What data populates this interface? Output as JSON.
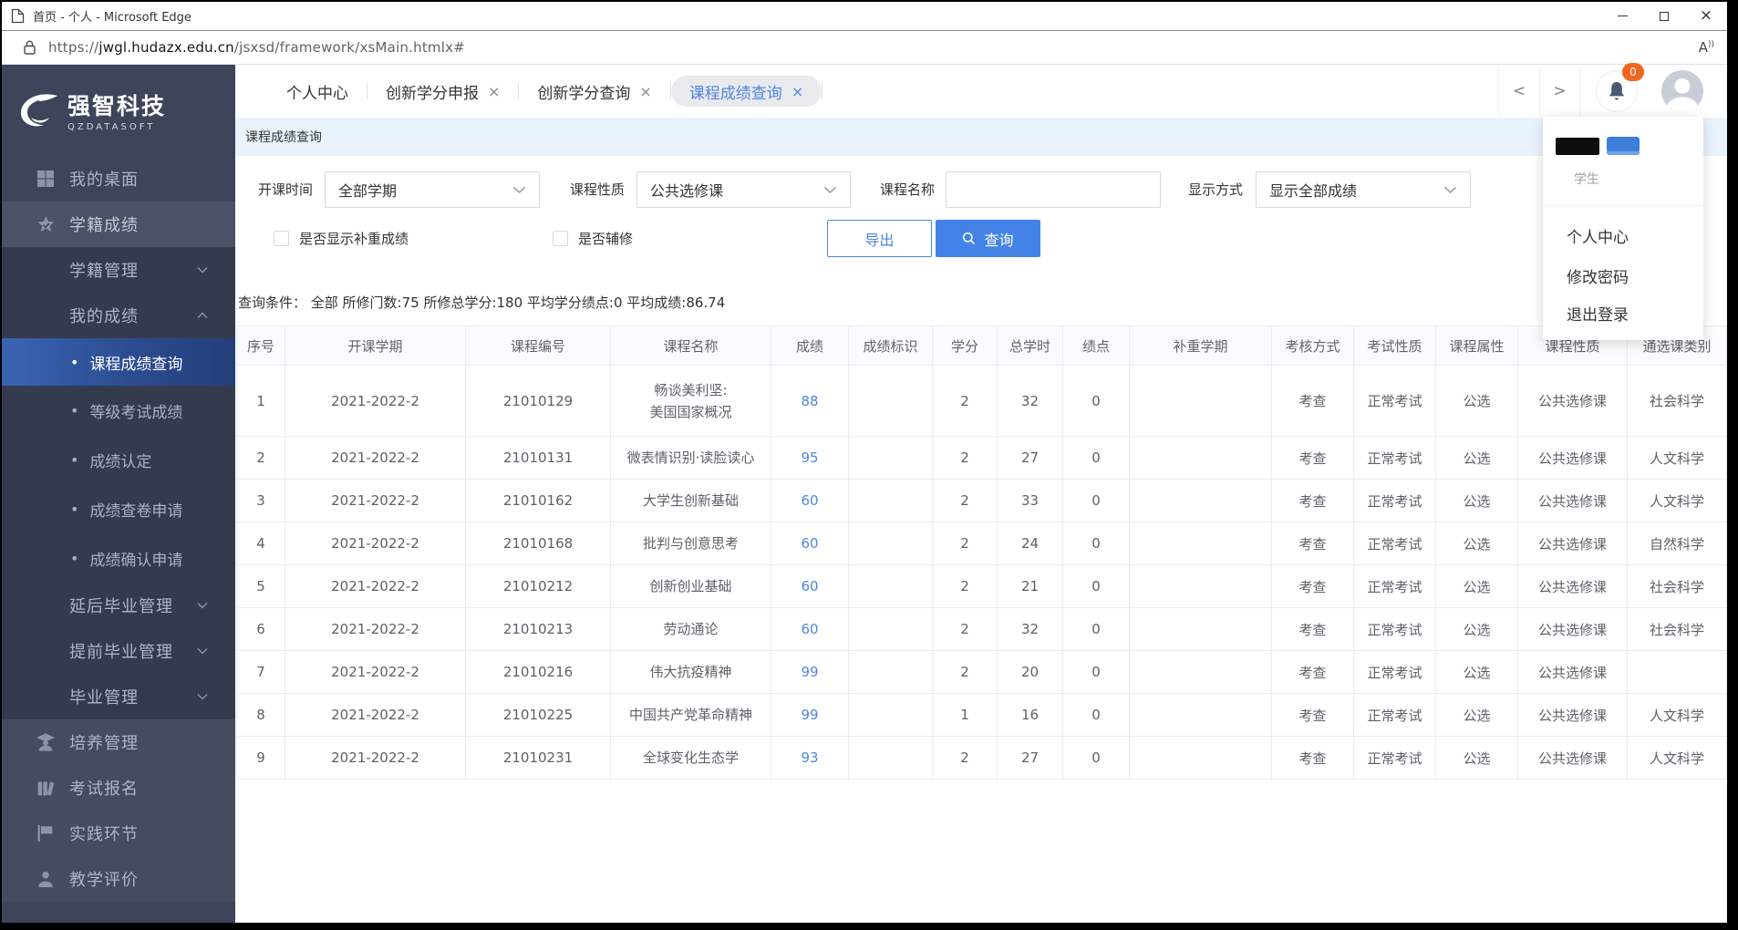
{
  "window": {
    "title": "首页 - 个人 - Microsoft Edge"
  },
  "address": {
    "scheme": "https://",
    "domain": "jwgl.hudazx.edu.cn",
    "path": "/jsxsd/framework/xsMain.htmlx#",
    "read_aloud": "A"
  },
  "logo": {
    "title": "强智科技",
    "subtitle": "QZDATASOFT"
  },
  "sidebar": {
    "sections": [
      {
        "style": "plain",
        "items": [
          {
            "label": "我的桌面",
            "icon": "desktop-icon"
          }
        ]
      },
      {
        "style": "highlight",
        "items": [
          {
            "label": "学籍成绩",
            "icon": "star-icon"
          }
        ]
      },
      {
        "style": "dark",
        "items": [
          {
            "label": "学籍管理",
            "chevron": "down"
          },
          {
            "label": "我的成绩",
            "chevron": "up",
            "children": [
              {
                "label": "课程成绩查询",
                "active": true
              },
              {
                "label": "等级考试成绩"
              },
              {
                "label": "成绩认定"
              },
              {
                "label": "成绩查卷申请"
              },
              {
                "label": "成绩确认申请"
              }
            ]
          },
          {
            "label": "延后毕业管理",
            "chevron": "down"
          },
          {
            "label": "提前毕业管理",
            "chevron": "down"
          },
          {
            "label": "毕业管理",
            "chevron": "down"
          }
        ]
      },
      {
        "style": "light",
        "items": [
          {
            "label": "培养管理",
            "icon": "graduate-icon"
          },
          {
            "label": "考试报名",
            "icon": "books-icon"
          },
          {
            "label": "实践环节",
            "icon": "flag-icon"
          },
          {
            "label": "教学评价",
            "icon": "person-icon"
          }
        ]
      }
    ]
  },
  "tabs": [
    {
      "label": "个人中心",
      "closable": false,
      "active": false
    },
    {
      "label": "创新学分申报",
      "closable": true,
      "active": false
    },
    {
      "label": "创新学分查询",
      "closable": true,
      "active": false
    },
    {
      "label": "课程成绩查询",
      "closable": true,
      "active": true
    }
  ],
  "topbar": {
    "notification_count": "0",
    "close_glyph": "×",
    "back_glyph": "<",
    "forward_glyph": ">"
  },
  "user_menu": {
    "role": "学生",
    "items": [
      {
        "label": "个人中心"
      },
      {
        "label": "修改密码"
      },
      {
        "label": "退出登录"
      }
    ]
  },
  "page": {
    "breadcrumb": "课程成绩查询"
  },
  "filters": {
    "term": {
      "label": "开课时间",
      "value": "全部学期"
    },
    "nature": {
      "label": "课程性质",
      "value": "公共选修课"
    },
    "course": {
      "label": "课程名称",
      "value": ""
    },
    "display": {
      "label": "显示方式",
      "value": "显示全部成绩"
    },
    "checkbox_makeup": "是否显示补重成绩",
    "checkbox_minor": "是否辅修",
    "export_button": "导出",
    "query_button": "查询"
  },
  "summary": "查询条件： 全部 所修门数:75 所修总学分:180 平均学分绩点:0 平均成绩:86.74",
  "table": {
    "headers": [
      "序号",
      "开课学期",
      "课程编号",
      "课程名称",
      "成绩",
      "成绩标识",
      "学分",
      "总学时",
      "绩点",
      "补重学期",
      "考核方式",
      "考试性质",
      "课程属性",
      "课程性质",
      "通选课类别"
    ],
    "rows": [
      [
        "1",
        "2021-2022-2",
        "21010129",
        "畅谈美利坚:\n美国国家概况",
        "88",
        "",
        "2",
        "32",
        "0",
        "",
        "考查",
        "正常考试",
        "公选",
        "公共选修课",
        "社会科学"
      ],
      [
        "2",
        "2021-2022-2",
        "21010131",
        "微表情识别·读脸读心",
        "95",
        "",
        "2",
        "27",
        "0",
        "",
        "考查",
        "正常考试",
        "公选",
        "公共选修课",
        "人文科学"
      ],
      [
        "3",
        "2021-2022-2",
        "21010162",
        "大学生创新基础",
        "60",
        "",
        "2",
        "33",
        "0",
        "",
        "考查",
        "正常考试",
        "公选",
        "公共选修课",
        "人文科学"
      ],
      [
        "4",
        "2021-2022-2",
        "21010168",
        "批判与创意思考",
        "60",
        "",
        "2",
        "24",
        "0",
        "",
        "考查",
        "正常考试",
        "公选",
        "公共选修课",
        "自然科学"
      ],
      [
        "5",
        "2021-2022-2",
        "21010212",
        "创新创业基础",
        "60",
        "",
        "2",
        "21",
        "0",
        "",
        "考查",
        "正常考试",
        "公选",
        "公共选修课",
        "社会科学"
      ],
      [
        "6",
        "2021-2022-2",
        "21010213",
        "劳动通论",
        "60",
        "",
        "2",
        "32",
        "0",
        "",
        "考查",
        "正常考试",
        "公选",
        "公共选修课",
        "社会科学"
      ],
      [
        "7",
        "2021-2022-2",
        "21010216",
        "伟大抗疫精神",
        "99",
        "",
        "2",
        "20",
        "0",
        "",
        "考查",
        "正常考试",
        "公选",
        "公共选修课",
        ""
      ],
      [
        "8",
        "2021-2022-2",
        "21010225",
        "中国共产党革命精神",
        "99",
        "",
        "1",
        "16",
        "0",
        "",
        "考查",
        "正常考试",
        "公选",
        "公共选修课",
        "人文科学"
      ],
      [
        "9",
        "2021-2022-2",
        "21010231",
        "全球变化生态学",
        "93",
        "",
        "2",
        "27",
        "0",
        "",
        "考查",
        "正常考试",
        "公选",
        "公共选修课",
        "人文科学"
      ]
    ]
  }
}
